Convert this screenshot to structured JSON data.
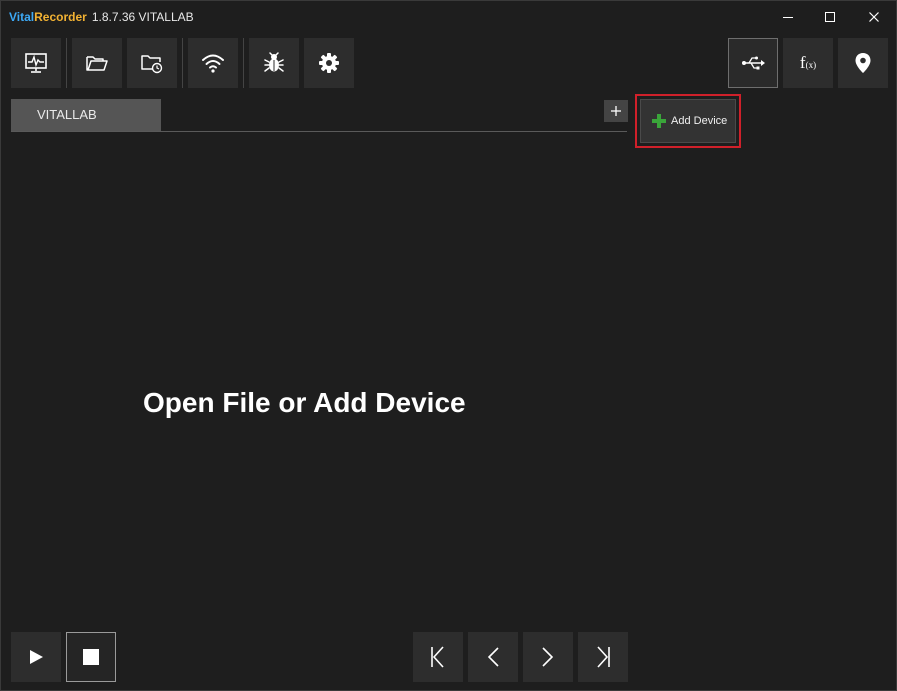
{
  "window": {
    "app_name_part1": "Vital",
    "app_name_part2": "Recorder",
    "version_text": "1.8.7.36 VITALLAB"
  },
  "window_controls": [
    "minimize-icon",
    "maximize-icon",
    "close-icon"
  ],
  "toolbar": {
    "left_icons": [
      "monitor-icon",
      "folder-open-icon",
      "folder-recent-icon",
      "wifi-icon",
      "bug-icon",
      "gear-icon"
    ],
    "right_icons": [
      "usb-icon",
      "function-icon",
      "location-pin-icon"
    ],
    "function_icon_text": "f",
    "function_icon_sub": "(x)"
  },
  "tabs": [
    {
      "label": "VITALLAB"
    }
  ],
  "add_tab_icon": "plus-icon",
  "popup": {
    "add_device_label": "Add Device",
    "accent_color": "#3aa53a",
    "border_color": "#d0202a"
  },
  "main": {
    "message": "Open File or Add Device"
  },
  "bottom_bar": {
    "playback_icons": [
      "play-icon",
      "stop-icon"
    ],
    "navigation_icons": [
      "skip-to-start-icon",
      "previous-icon",
      "next-icon",
      "skip-to-end-icon"
    ]
  }
}
